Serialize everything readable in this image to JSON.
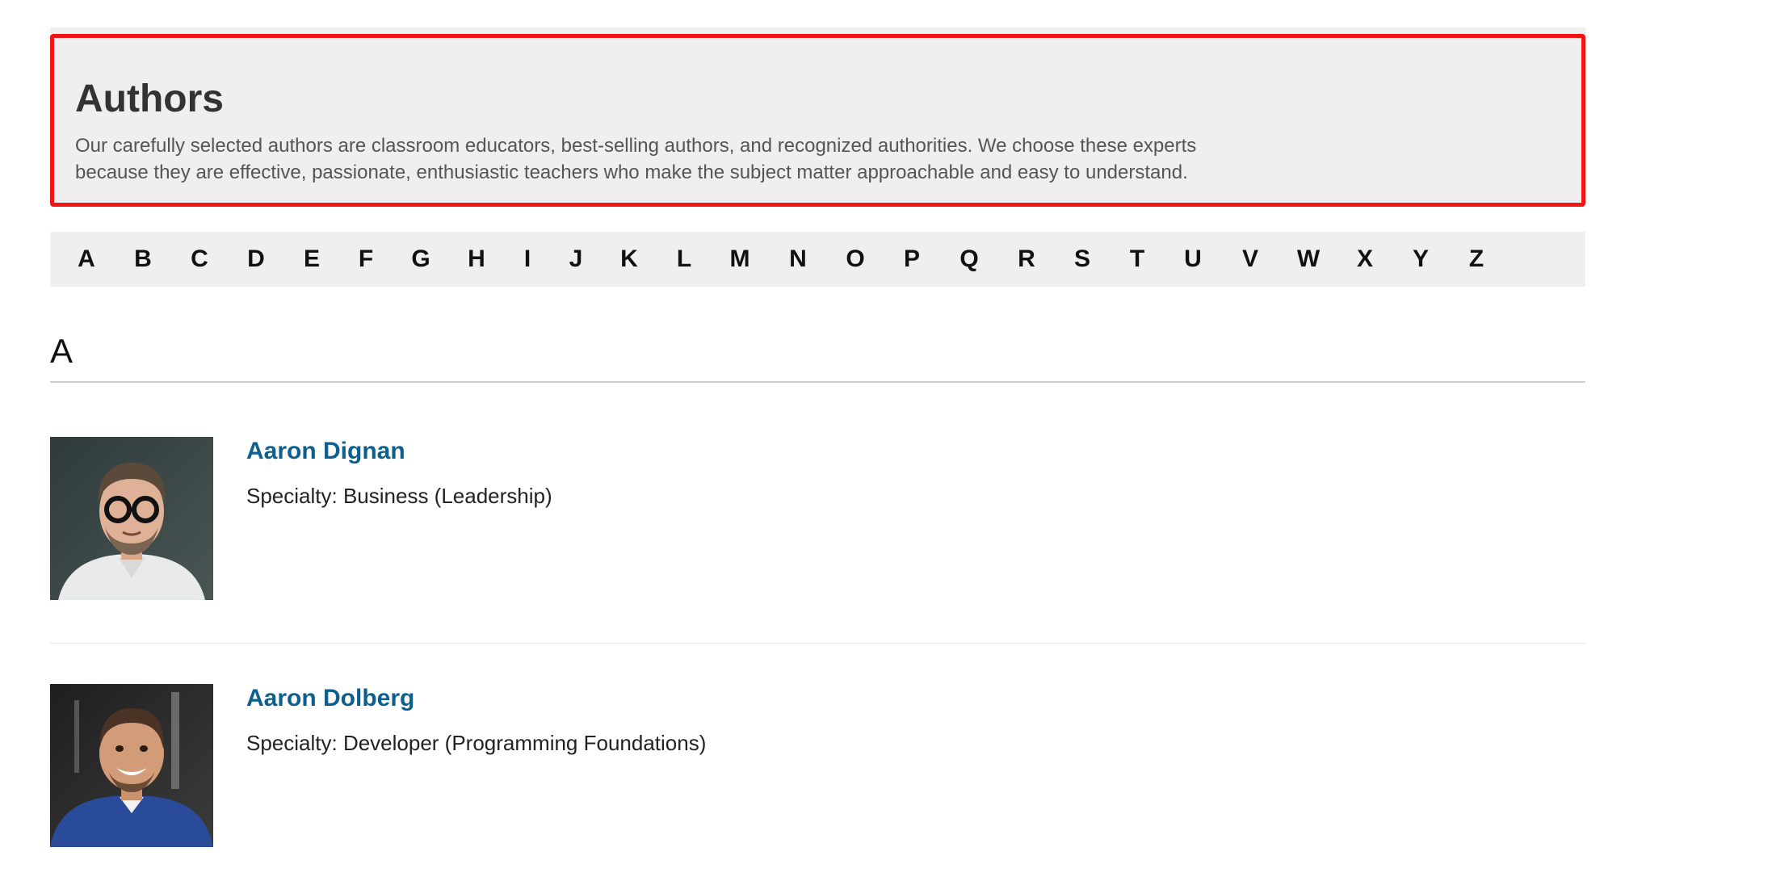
{
  "hero": {
    "title": "Authors",
    "description_line1": "Our carefully selected authors are classroom educators, best-selling authors, and recognized authorities. We choose these experts",
    "description_line2": "because they are effective, passionate, enthusiastic teachers who make the subject matter approachable and easy to understand."
  },
  "alphabet": [
    "A",
    "B",
    "C",
    "D",
    "E",
    "F",
    "G",
    "H",
    "I",
    "J",
    "K",
    "L",
    "M",
    "N",
    "O",
    "P",
    "Q",
    "R",
    "S",
    "T",
    "U",
    "V",
    "W",
    "X",
    "Y",
    "Z"
  ],
  "section": {
    "letter": "A"
  },
  "authors": [
    {
      "name": "Aaron Dignan",
      "specialty": "Specialty: Business (Leadership)"
    },
    {
      "name": "Aaron Dolberg",
      "specialty": "Specialty: Developer (Programming Foundations)"
    }
  ],
  "colors": {
    "accent_link": "#0d5f8e",
    "highlight_border": "#f01414",
    "panel_bg": "#efefef"
  }
}
